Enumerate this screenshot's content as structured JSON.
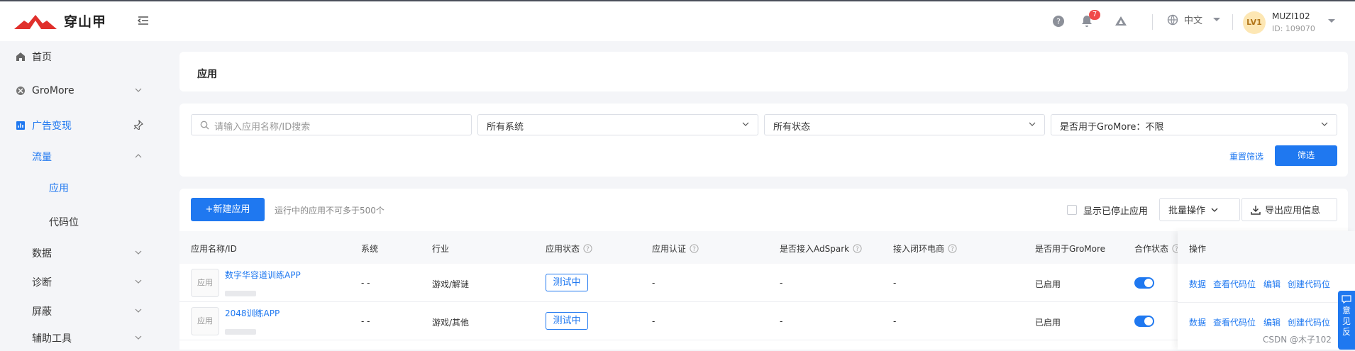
{
  "header": {
    "logo_text": "穿山甲",
    "notification_count": "7",
    "language": "中文",
    "user": {
      "avatar_text": "LV1",
      "name": "MUZI102",
      "id": "ID: 109070"
    }
  },
  "sidebar": {
    "items": [
      {
        "label": "首页"
      },
      {
        "label": "GroMore"
      },
      {
        "label": "广告变现"
      },
      {
        "label": "流量"
      },
      {
        "label": "应用"
      },
      {
        "label": "代码位"
      },
      {
        "label": "数据"
      },
      {
        "label": "诊断"
      },
      {
        "label": "屏蔽"
      },
      {
        "label": "辅助工具"
      }
    ]
  },
  "page": {
    "title": "应用"
  },
  "filters": {
    "search_placeholder": "请输入应用名称/ID搜索",
    "system": "所有系统",
    "status": "所有状态",
    "gromore": "是否用于GroMore：不限",
    "reset_label": "重置筛选",
    "filter_label": "筛选"
  },
  "toolbar": {
    "new_app_label": "+新建应用",
    "hint": "运行中的应用不可多于500个",
    "show_stopped_label": "显示已停止应用",
    "batch_label": "批量操作",
    "export_label": "导出应用信息"
  },
  "table": {
    "columns": [
      "应用名称/ID",
      "系统",
      "行业",
      "应用状态",
      "应用认证",
      "是否接入AdSpark",
      "接入闭环电商",
      "是否用于GroMore",
      "合作状态",
      "操作"
    ],
    "rows": [
      {
        "icon_text": "应用",
        "name": "数字华容道训练APP",
        "system": "- -",
        "industry": "游戏/解谜",
        "status": "测试中",
        "auth": "-",
        "adspark": "-",
        "ecommerce": "-",
        "gromore": "已启用",
        "coop_on": true
      },
      {
        "icon_text": "应用",
        "name": "2048训练APP",
        "system": "- -",
        "industry": "游戏/其他",
        "status": "测试中",
        "auth": "-",
        "adspark": "-",
        "ecommerce": "-",
        "gromore": "已启用",
        "coop_on": true
      }
    ],
    "actions": [
      "数据",
      "查看代码位",
      "编辑",
      "创建代码位"
    ]
  },
  "feedback_chars": [
    "意",
    "见",
    "反"
  ],
  "watermark": "CSDN @木子102",
  "colors": {
    "accent": "#1f78f0",
    "badge": "#f04a4a"
  }
}
